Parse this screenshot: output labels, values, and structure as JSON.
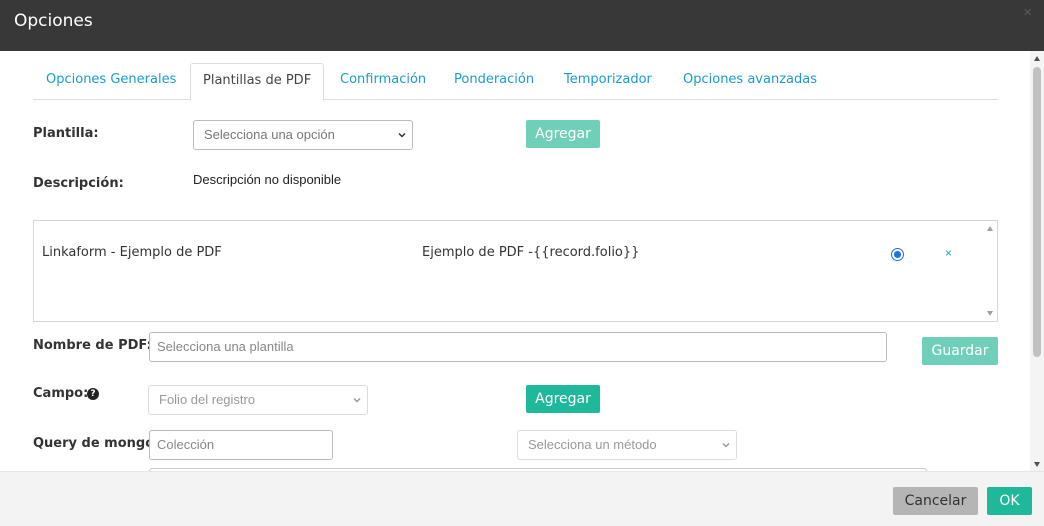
{
  "dialog": {
    "title": "Opciones"
  },
  "tabs": [
    {
      "label": "Opciones Generales"
    },
    {
      "label": "Plantillas de PDF"
    },
    {
      "label": "Confirmación"
    },
    {
      "label": "Ponderación"
    },
    {
      "label": "Temporizador"
    },
    {
      "label": "Opciones avanzadas"
    }
  ],
  "form": {
    "template_label": "Plantilla:",
    "template_select_value": "Selecciona una opción",
    "add_label": "Agregar",
    "description_label": "Descripción:",
    "description_value": "Descripción no disponible",
    "pdf_name_label": "Nombre de PDF:",
    "pdf_name_placeholder": "Selecciona una plantilla",
    "save_label": "Guardar",
    "field_label": "Campo:",
    "field_select_value": "Folio del registro",
    "add_field_label": "Agregar",
    "mongo_query_label": "Query de mongo:",
    "collection_placeholder": "Colección",
    "method_select_value": "Selecciona un método"
  },
  "templates_list": [
    {
      "name": "Linkaform - Ejemplo de PDF",
      "pdf_name": "Ejemplo de PDF -{{record.folio}}",
      "selected": true
    }
  ],
  "footer": {
    "cancel_label": "Cancelar",
    "ok_label": "OK"
  },
  "colors": {
    "header_bg": "#383838",
    "link": "#1a9ccf",
    "teal": "#1fb89b",
    "teal_light": "#6fcfb8"
  }
}
